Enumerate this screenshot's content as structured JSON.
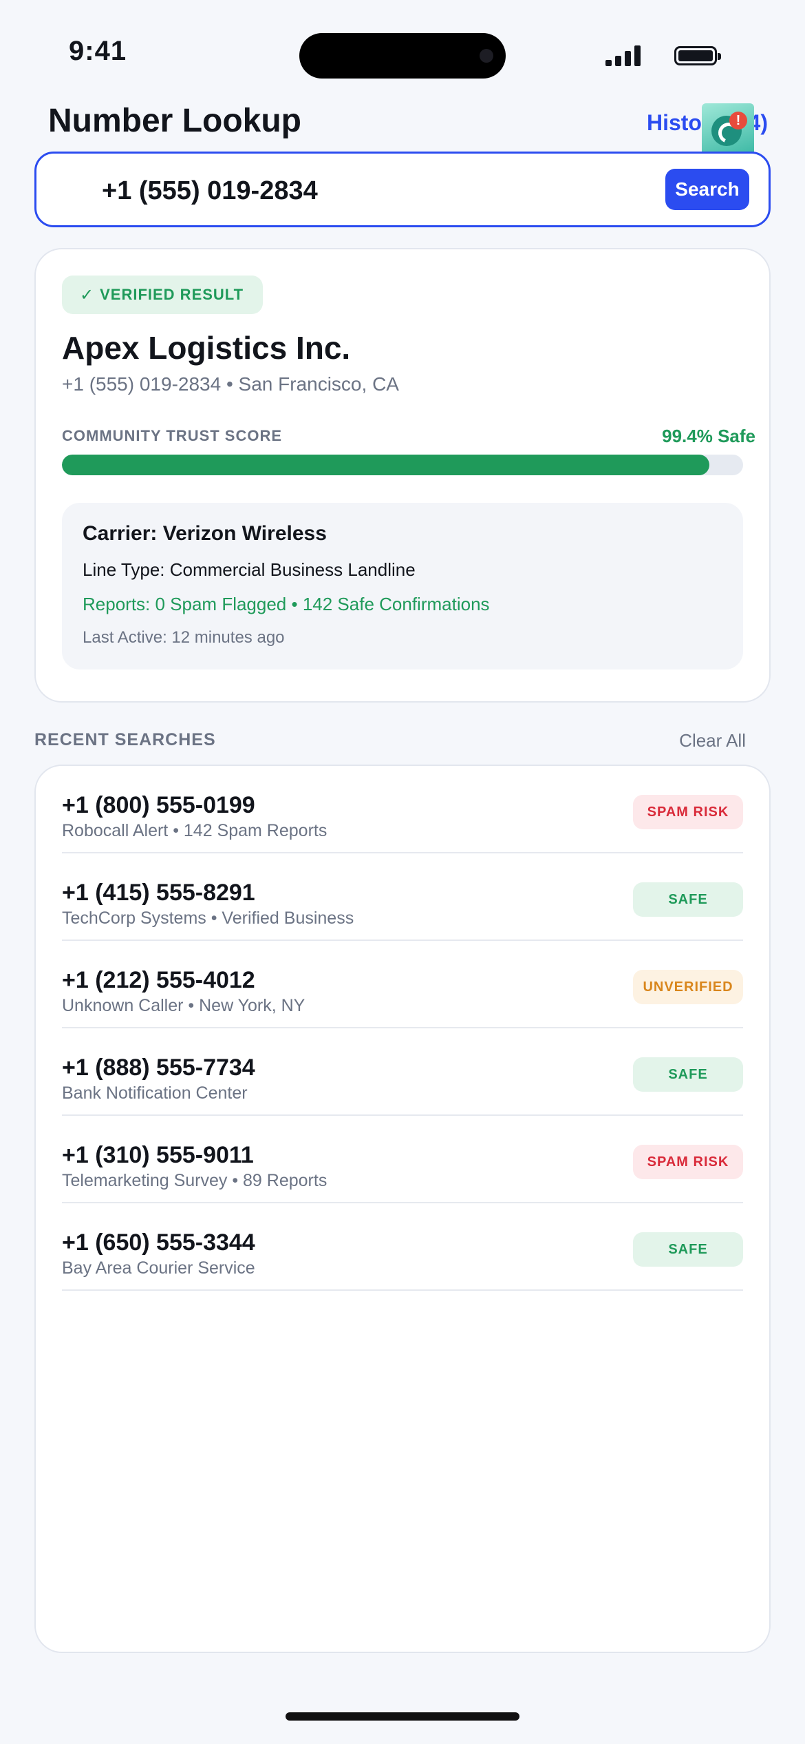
{
  "status_bar": {
    "time": "9:41"
  },
  "header": {
    "title": "Number Lookup",
    "history_label": "History (14)"
  },
  "search": {
    "value": "+1 (555) 019-2834",
    "button_label": "Search"
  },
  "result": {
    "verified_label": "VERIFIED RESULT",
    "name": "Apex Logistics Inc.",
    "subtitle": "+1 (555) 019-2834 • San Francisco, CA",
    "trust_label": "COMMUNITY TRUST SCORE",
    "trust_value": "99.4% Safe",
    "trust_score": 0.95,
    "carrier": "Carrier: Verizon Wireless",
    "line_type": "Line Type: Commercial Business Landline",
    "reports": "Reports: 0 Spam Flagged • 142 Safe Confirmations",
    "last_active": "Last Active: 12 minutes ago"
  },
  "recent": {
    "title": "RECENT SEARCHES",
    "clear_label": "Clear All",
    "items": [
      {
        "number": "+1 (800) 555-0199",
        "meta": "Robocall Alert • 142 Spam Reports",
        "status": "SPAM RISK",
        "kind": "spam"
      },
      {
        "number": "+1 (415) 555-8291",
        "meta": "TechCorp Systems • Verified Business",
        "status": "SAFE",
        "kind": "safe"
      },
      {
        "number": "+1 (212) 555-4012",
        "meta": "Unknown Caller • New York, NY",
        "status": "UNVERIFIED",
        "kind": "unverified"
      },
      {
        "number": "+1 (888) 555-7734",
        "meta": "Bank Notification Center",
        "status": "SAFE",
        "kind": "safe"
      },
      {
        "number": "+1 (310) 555-9011",
        "meta": "Telemarketing Survey • 89 Reports",
        "status": "SPAM RISK",
        "kind": "spam"
      },
      {
        "number": "+1 (650) 555-3344",
        "meta": "Bay Area Courier Service",
        "status": "SAFE",
        "kind": "safe"
      }
    ]
  },
  "colors": {
    "accent": "#2b4cf0",
    "safe": "#1f9a5a",
    "safe_bg": "#e3f4ea",
    "spam": "#d92b3a",
    "spam_bg": "#fde8ea",
    "unverified": "#d9861c",
    "unverified_bg": "#fdf2e2"
  },
  "icons": {
    "verified": "check-icon",
    "app": "phone-alert-icon"
  }
}
